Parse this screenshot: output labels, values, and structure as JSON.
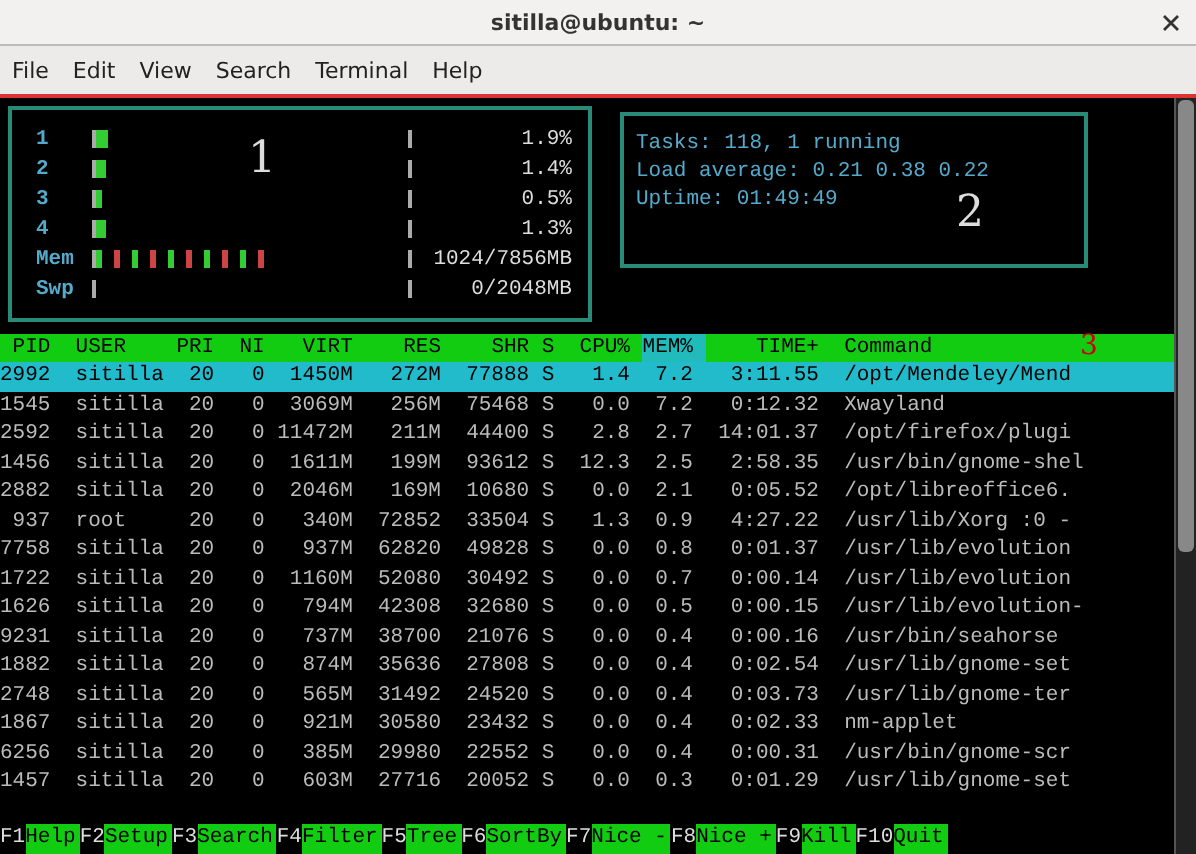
{
  "window": {
    "title": "sitilla@ubuntu: ~"
  },
  "menu": [
    "File",
    "Edit",
    "View",
    "Search",
    "Terminal",
    "Help"
  ],
  "meters": [
    {
      "label": "1",
      "level": 0.04,
      "reading": "1.9%"
    },
    {
      "label": "2",
      "level": 0.03,
      "reading": "1.4%"
    },
    {
      "label": "3",
      "level": 0.02,
      "reading": "0.5%"
    },
    {
      "label": "4",
      "level": 0.03,
      "reading": "1.3%"
    },
    {
      "label": "Mem",
      "level": 0.55,
      "reading": "1024/7856MB"
    },
    {
      "label": "Swp",
      "reading": "0/2048MB"
    }
  ],
  "summary": [
    "Tasks: 118, 1 running",
    "Load average: 0.21 0.38 0.22",
    "Uptime: 01:49:49"
  ],
  "callouts": [
    "1",
    "2",
    "3"
  ],
  "table": {
    "columns": [
      {
        "label": "PID",
        "selected": false
      },
      {
        "label": "USER",
        "selected": false
      },
      {
        "label": "PRI",
        "selected": false
      },
      {
        "label": "NI",
        "selected": false
      },
      {
        "label": "VIRT",
        "selected": false
      },
      {
        "label": "RES",
        "selected": false
      },
      {
        "label": "SHR",
        "selected": false
      },
      {
        "label": "S",
        "selected": false
      },
      {
        "label": "CPU%",
        "selected": false
      },
      {
        "label": "MEM%",
        "selected": true
      },
      {
        "label": "TIME+",
        "selected": false
      },
      {
        "label": "Command",
        "selected": false
      }
    ],
    "rows": [
      {
        "selected": true,
        "cells": [
          "2992",
          "sitilla",
          "20",
          "0",
          "1450M",
          "272M",
          "77888",
          "S",
          "1.4",
          "7.2",
          "3:11.55",
          "/opt/Mendeley/Mend"
        ]
      },
      {
        "selected": false,
        "cells": [
          "1545",
          "sitilla",
          "20",
          "0",
          "3069M",
          "256M",
          "75468",
          "S",
          "0.0",
          "7.2",
          "0:12.32",
          "Xwayland"
        ]
      },
      {
        "selected": false,
        "cells": [
          "2592",
          "sitilla",
          "20",
          "0",
          "11472M",
          "211M",
          "44400",
          "S",
          "2.8",
          "2.7",
          "14:01.37",
          "/opt/firefox/plugi"
        ]
      },
      {
        "selected": false,
        "cells": [
          "1456",
          "sitilla",
          "20",
          "0",
          "1611M",
          "199M",
          "93612",
          "S",
          "12.3",
          "2.5",
          "2:58.35",
          "/usr/bin/gnome-shel"
        ]
      },
      {
        "selected": false,
        "cells": [
          "2882",
          "sitilla",
          "20",
          "0",
          "2046M",
          "169M",
          "10680",
          "S",
          "0.0",
          "2.1",
          "0:05.52",
          "/opt/libreoffice6."
        ]
      },
      {
        "selected": false,
        "cells": [
          "937",
          "root",
          "20",
          "0",
          "340M",
          "72852",
          "33504",
          "S",
          "1.3",
          "0.9",
          "4:27.22",
          "/usr/lib/Xorg :0 -"
        ]
      },
      {
        "selected": false,
        "cells": [
          "7758",
          "sitilla",
          "20",
          "0",
          "937M",
          "62820",
          "49828",
          "S",
          "0.0",
          "0.8",
          "0:01.37",
          "/usr/lib/evolution"
        ]
      },
      {
        "selected": false,
        "cells": [
          "1722",
          "sitilla",
          "20",
          "0",
          "1160M",
          "52080",
          "30492",
          "S",
          "0.0",
          "0.7",
          "0:00.14",
          "/usr/lib/evolution"
        ]
      },
      {
        "selected": false,
        "cells": [
          "1626",
          "sitilla",
          "20",
          "0",
          "794M",
          "42308",
          "32680",
          "S",
          "0.0",
          "0.5",
          "0:00.15",
          "/usr/lib/evolution-"
        ]
      },
      {
        "selected": false,
        "cells": [
          "9231",
          "sitilla",
          "20",
          "0",
          "737M",
          "38700",
          "21076",
          "S",
          "0.0",
          "0.4",
          "0:00.16",
          "/usr/bin/seahorse"
        ]
      },
      {
        "selected": false,
        "cells": [
          "1882",
          "sitilla",
          "20",
          "0",
          "874M",
          "35636",
          "27808",
          "S",
          "0.0",
          "0.4",
          "0:02.54",
          "/usr/lib/gnome-set"
        ]
      },
      {
        "selected": false,
        "cells": [
          "2748",
          "sitilla",
          "20",
          "0",
          "565M",
          "31492",
          "24520",
          "S",
          "0.0",
          "0.4",
          "0:03.73",
          "/usr/lib/gnome-ter"
        ]
      },
      {
        "selected": false,
        "cells": [
          "1867",
          "sitilla",
          "20",
          "0",
          "921M",
          "30580",
          "23432",
          "S",
          "0.0",
          "0.4",
          "0:02.33",
          "nm-applet"
        ]
      },
      {
        "selected": false,
        "cells": [
          "6256",
          "sitilla",
          "20",
          "0",
          "385M",
          "29980",
          "22552",
          "S",
          "0.0",
          "0.4",
          "0:00.31",
          "/usr/bin/gnome-scr"
        ]
      },
      {
        "selected": false,
        "cells": [
          "1457",
          "sitilla",
          "20",
          "0",
          "603M",
          "27716",
          "20052",
          "S",
          "0.0",
          "0.3",
          "0:01.29",
          "/usr/lib/gnome-set"
        ]
      }
    ]
  },
  "function_bar": [
    {
      "key": "F1",
      "label": "Help"
    },
    {
      "key": "F2",
      "label": "Setup"
    },
    {
      "key": "F3",
      "label": "Search"
    },
    {
      "key": "F4",
      "label": "Filter"
    },
    {
      "key": "F5",
      "label": "Tree"
    },
    {
      "key": "F6",
      "label": "SortBy"
    },
    {
      "key": "F7",
      "label": "Nice -"
    },
    {
      "key": "F8",
      "label": "Nice +"
    },
    {
      "key": "F9",
      "label": "Kill"
    },
    {
      "key": "F10",
      "label": "Quit"
    }
  ]
}
